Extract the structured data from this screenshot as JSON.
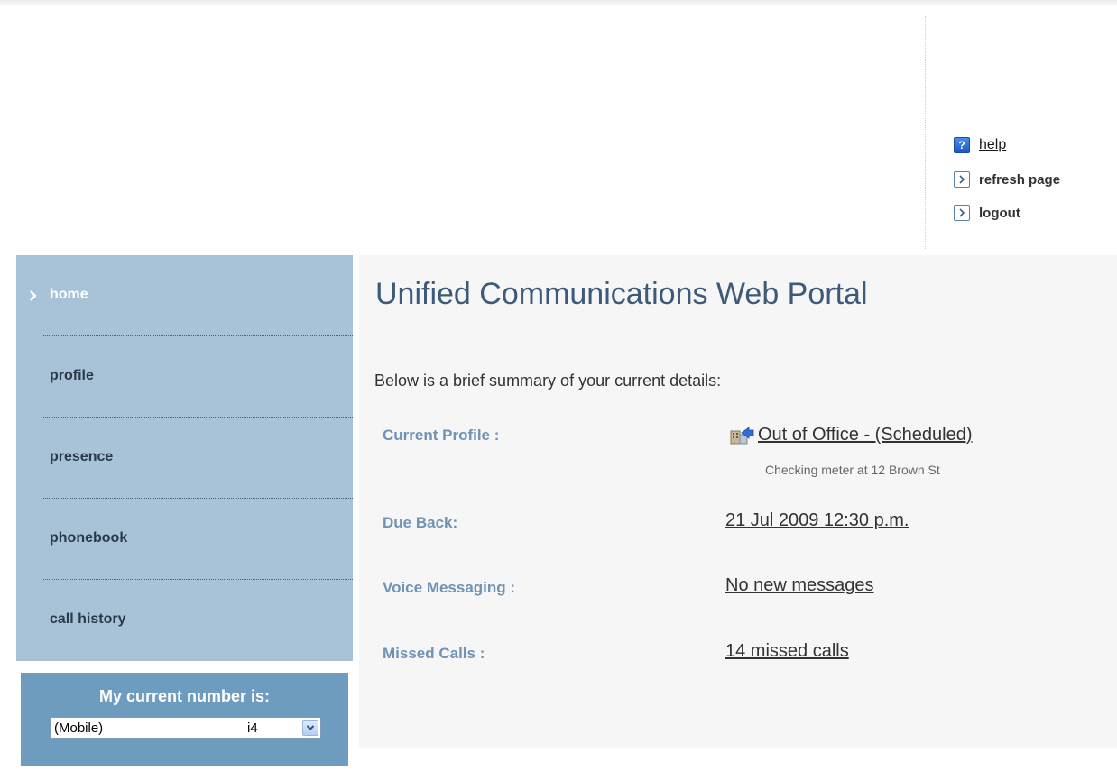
{
  "utility_links": {
    "help": "help",
    "refresh": "refresh page",
    "logout": "logout"
  },
  "sidebar": {
    "items": [
      {
        "label": "home",
        "active": true
      },
      {
        "label": "profile",
        "active": false
      },
      {
        "label": "presence",
        "active": false
      },
      {
        "label": "phonebook",
        "active": false
      },
      {
        "label": "call history",
        "active": false
      }
    ]
  },
  "number_box": {
    "title": "My current number is:",
    "selected_label": "(Mobile)",
    "selected_tail": "i4"
  },
  "main": {
    "title": "Unified Communications Web Portal",
    "intro": "Below is a brief summary of your current details:",
    "rows": {
      "profile": {
        "label": "Current Profile :",
        "value": "Out of Office - (Scheduled)",
        "note": "Checking meter at 12 Brown St"
      },
      "due_back": {
        "label": "Due Back:",
        "value": "21 Jul 2009 12:30 p.m."
      },
      "voice": {
        "label": "Voice Messaging :",
        "value": "No new messages"
      },
      "missed": {
        "label": "Missed Calls :",
        "value": "14 missed calls"
      }
    }
  },
  "colors": {
    "sidebar_bg": "#a8c3d7",
    "number_box_bg": "#6e9cbf",
    "title_color": "#3e5a7a",
    "label_color": "#6f93b4"
  },
  "icons": {
    "help": "help-icon",
    "refresh": "arrow-right-icon",
    "logout": "arrow-right-icon",
    "profile": "out-of-office-icon",
    "nav_active": "chevron-right-icon"
  }
}
